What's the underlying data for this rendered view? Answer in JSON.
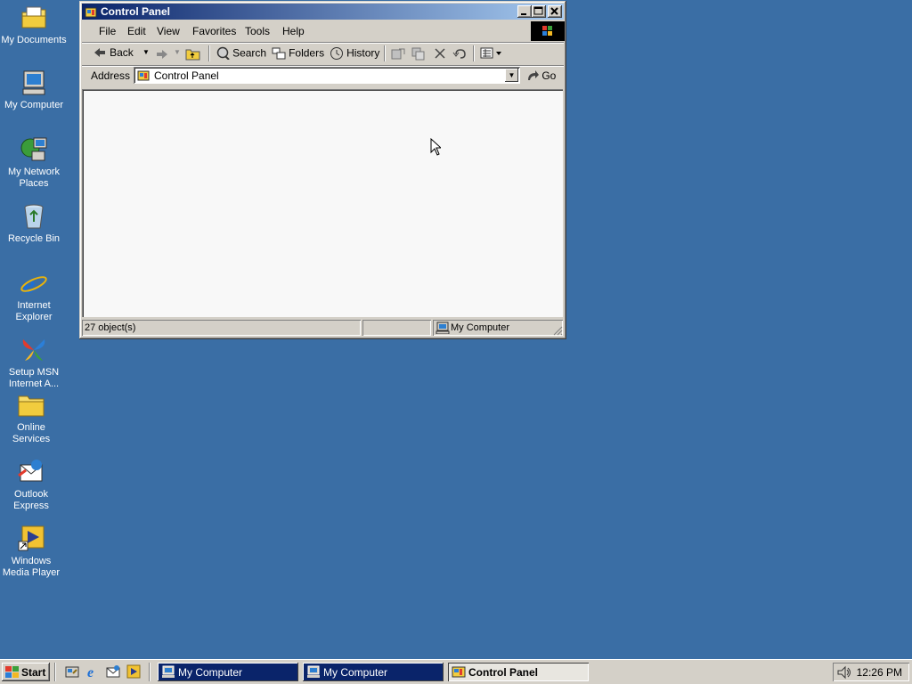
{
  "desktop": {
    "icons": [
      {
        "label": "My Documents",
        "icon": "my-documents-icon"
      },
      {
        "label": "My Computer",
        "icon": "my-computer-icon"
      },
      {
        "label": "My Network Places",
        "icon": "network-places-icon"
      },
      {
        "label": "Recycle Bin",
        "icon": "recycle-bin-icon"
      },
      {
        "label": "Internet Explorer",
        "icon": "internet-explorer-icon"
      },
      {
        "label": "Setup MSN Internet A...",
        "icon": "msn-butterfly-icon"
      },
      {
        "label": "Online Services",
        "icon": "folder-icon"
      },
      {
        "label": "Outlook Express",
        "icon": "outlook-express-icon"
      },
      {
        "label": "Windows Media Player",
        "icon": "media-player-icon"
      }
    ],
    "background_color": "#3a6ea5"
  },
  "window": {
    "title": "Control Panel",
    "menu": [
      "File",
      "Edit",
      "View",
      "Favorites",
      "Tools",
      "Help"
    ],
    "toolbar": {
      "back": "Back",
      "search": "Search",
      "folders": "Folders",
      "history": "History"
    },
    "address": {
      "label": "Address",
      "value": "Control Panel",
      "go": "Go"
    },
    "status": {
      "objects": "27 object(s)",
      "zone": "My Computer"
    },
    "title_gradient": [
      "#0a246a",
      "#a6caf0"
    ]
  },
  "taskbar": {
    "start": "Start",
    "tasks": [
      {
        "label": "My Computer",
        "active": false
      },
      {
        "label": "My Computer",
        "active": false
      },
      {
        "label": "Control Panel",
        "active": true
      }
    ],
    "clock": "12:26 PM"
  }
}
